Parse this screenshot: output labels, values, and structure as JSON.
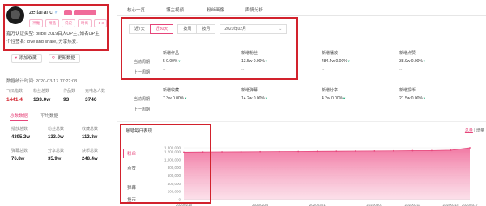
{
  "profile": {
    "username": "zettaranc",
    "gender_symbol": "♂",
    "tags": [
      "神魔",
      "精选",
      "说说",
      "时尚",
      "-1-3"
    ],
    "bio_line1": "嘉万认证类型: bilibili 2019百大UP主, 知名UP主",
    "bio_line2": "个性签名: love and share, 分享热爱."
  },
  "actions": {
    "add_favorite": "添加收藏",
    "update_data": "更新数据"
  },
  "meta": {
    "label": "数据统计时间:",
    "value": "2020-03-17 17:22:03"
  },
  "stats": {
    "headers": [
      "飞瓜指数",
      "粉丝总数",
      "作品数",
      "充电总人数"
    ],
    "values": [
      "1441.4",
      "133.0w",
      "93",
      "3740"
    ]
  },
  "left_tabs": [
    "总数数据",
    "平均数据"
  ],
  "grid": [
    {
      "label": "播放总数",
      "value": "4395.2w"
    },
    {
      "label": "粉丝总数",
      "value": "133.0w"
    },
    {
      "label": "收藏总数",
      "value": "112.3w"
    },
    {
      "label": "弹幕总数",
      "value": "76.8w"
    },
    {
      "label": "分享总数",
      "value": "35.9w"
    },
    {
      "label": "获币总数",
      "value": "248.4w"
    }
  ],
  "top_tabs": [
    "核心一览",
    "博主视频",
    "粉丝画像",
    "舆情分析"
  ],
  "period_buttons": [
    "近7天",
    "近30天",
    "按周",
    "按月"
  ],
  "date_select": "2020年02月",
  "row_labels": {
    "current": "当前周期",
    "previous": "上一周期"
  },
  "metrics_row1": [
    {
      "title": "新增作品",
      "value": "5",
      "change": "0.00%"
    },
    {
      "title": "新增粉丝",
      "value": "13.5w",
      "change": "0.00%"
    },
    {
      "title": "新增播放",
      "value": "484.4w",
      "change": "0.00%"
    },
    {
      "title": "新增点赞",
      "value": "38.9w",
      "change": "0.00%"
    }
  ],
  "metrics_row2": [
    {
      "title": "新增收藏",
      "value": "7.3w",
      "change": "0.00%"
    },
    {
      "title": "新增弹幕",
      "value": "14.2w",
      "change": "0.00%"
    },
    {
      "title": "新增分享",
      "value": "4.2w",
      "change": "0.00%"
    },
    {
      "title": "新增投币",
      "value": "21.5w",
      "change": "0.00%"
    }
  ],
  "previous_value": "--",
  "chart_section": {
    "title": "账号每日表现",
    "toggle_total": "总量",
    "toggle_increment": "增量",
    "menu": [
      "粉丝",
      "点赞",
      "弹幕",
      "投币"
    ]
  },
  "colors": {
    "accent": "#e6457a",
    "highlight_box": "#d2222d",
    "down": "#19a974"
  },
  "chart_data": {
    "type": "area",
    "x": [
      "20200216",
      "20200218",
      "20200220",
      "20200222",
      "20200224",
      "20200226",
      "20200228",
      "20200301",
      "20200303",
      "20200305",
      "20200307",
      "20200309",
      "20200311",
      "20200313",
      "20200315",
      "20200317"
    ],
    "x_tick_labels": [
      "20200216",
      "20200224",
      "20200301",
      "20200307",
      "20200311",
      "20200315",
      "20200317"
    ],
    "y_ticks": [
      0,
      200000,
      400000,
      600000,
      800000,
      1000000,
      1200000,
      1300000
    ],
    "y_tick_labels": [
      "0",
      "200,000",
      "400,000",
      "600,000",
      "800,000",
      "1,000,000",
      "1,200,000",
      "1,300,000"
    ],
    "series": [
      {
        "values": [
          1190000,
          1195000,
          1198000,
          1200000,
          1203000,
          1206000,
          1209000,
          1212000,
          1215000,
          1218000,
          1221000,
          1224000,
          1228000,
          1232000,
          1240000,
          1300000
        ]
      }
    ],
    "ylim": [
      0,
      1300000
    ],
    "grid": true
  }
}
